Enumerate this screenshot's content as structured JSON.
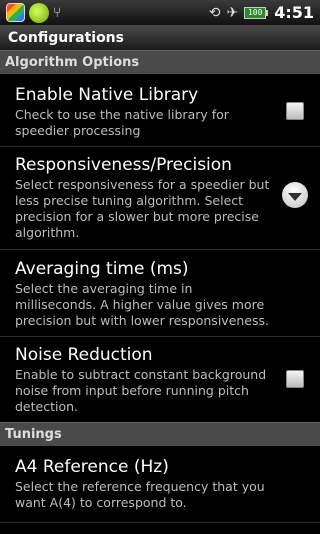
{
  "statusbar": {
    "time": "4:51",
    "battery": "100",
    "icons": [
      "colorful-app-icon",
      "green-app-icon",
      "usb-icon",
      "rotate-icon",
      "airplane-icon",
      "battery-icon"
    ]
  },
  "titlebar": {
    "title": "Configurations"
  },
  "sections": {
    "algorithm": "Algorithm Options",
    "tunings": "Tunings"
  },
  "prefs": [
    {
      "title": "Enable Native Library",
      "summary": "Check to use the native library for speedier processing",
      "widget": "checkbox",
      "checked": false
    },
    {
      "title": "Responsiveness/Precision",
      "summary": "Select responsiveness for a speedier but less precise tuning algorithm. Select precision for a slower but more precise algorithm.",
      "widget": "dropdown"
    },
    {
      "title": "Averaging time (ms)",
      "summary": "Select the averaging time in milliseconds. A higher value gives more precision but with lower responsiveness.",
      "widget": "none"
    },
    {
      "title": "Noise Reduction",
      "summary": "Enable to subtract constant background noise from input before running pitch detection.",
      "widget": "checkbox",
      "checked": false
    },
    {
      "title": "A4 Reference (Hz)",
      "summary": "Select the reference frequency that you want A(4) to correspond to.",
      "widget": "none"
    }
  ]
}
